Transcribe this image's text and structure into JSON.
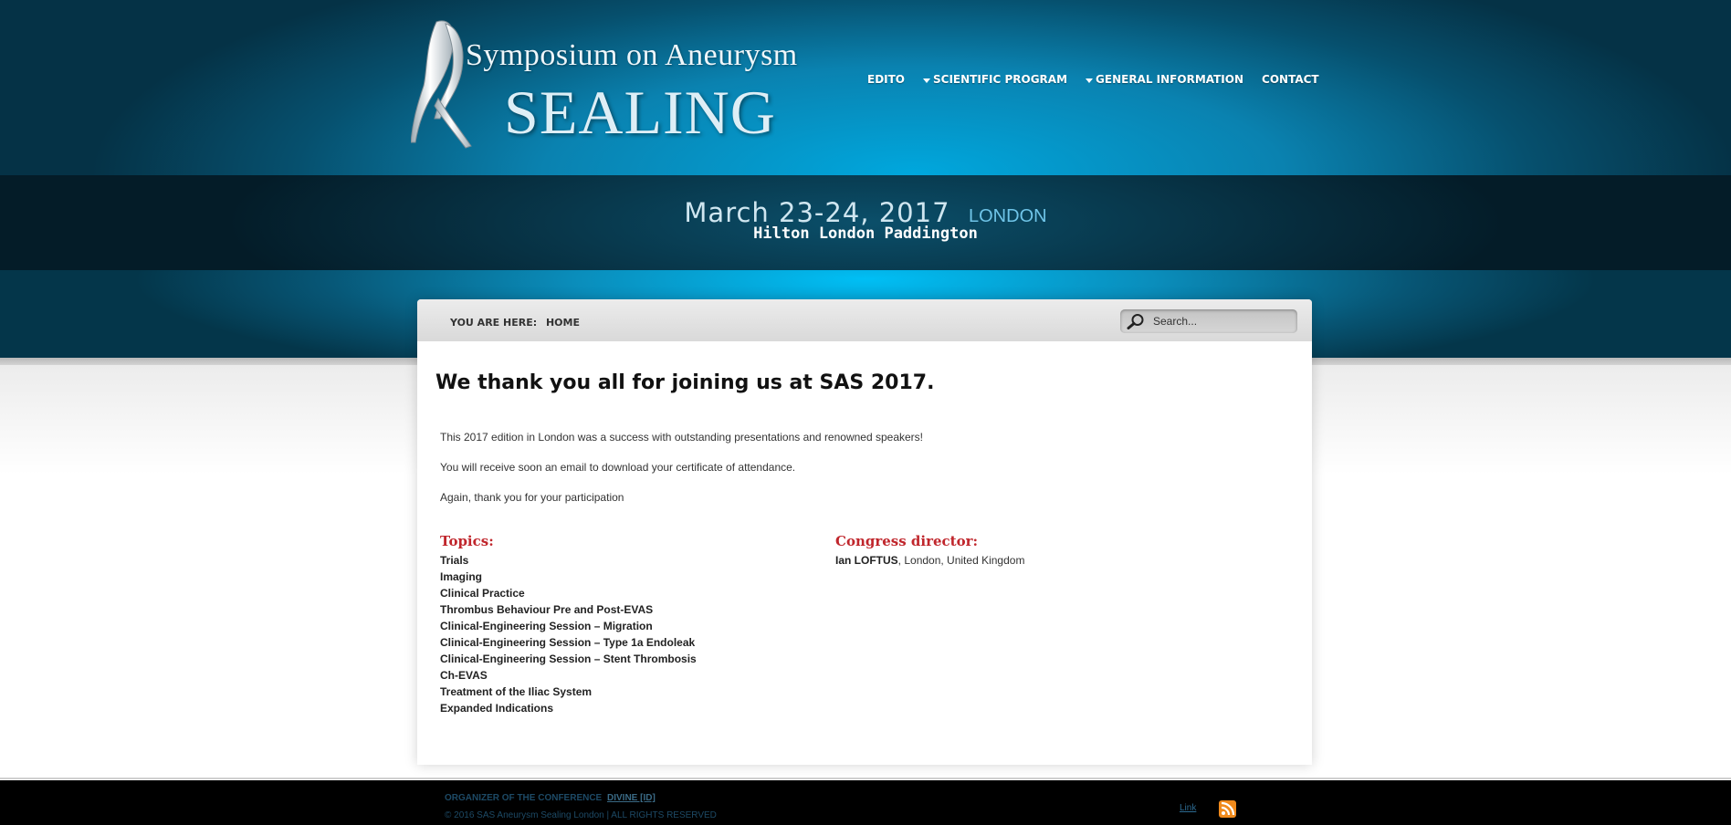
{
  "header": {
    "logo_line1": "Symposium on Aneurysm",
    "logo_line2": "SEALING",
    "nav": {
      "edito": "EDITO",
      "scientific_program": "SCIENTIFIC PROGRAM",
      "general_information": "GENERAL INFORMATION",
      "contact": "CONTACT"
    }
  },
  "event": {
    "date": "March 23-24, 2017",
    "city": "LONDON",
    "venue": "Hilton London Paddington"
  },
  "breadcrumb": {
    "prefix": "YOU ARE HERE:",
    "current": "HOME"
  },
  "search": {
    "placeholder": "Search..."
  },
  "content": {
    "headline": "We thank you all for joining us at SAS 2017.",
    "paragraphs": [
      "This 2017 edition in London was a success with outstanding presentations and renowned speakers!",
      "You will receive soon an email to download your certificate of attendance.",
      "Again, thank you for your participation"
    ],
    "topics_heading": "Topics:",
    "topics": [
      "Trials",
      "Imaging",
      "Clinical Practice",
      "Thrombus Behaviour Pre and Post-EVAS",
      "Clinical-Engineering Session – Migration",
      "Clinical-Engineering Session – Type 1a Endoleak",
      "Clinical-Engineering Session – Stent Thrombosis",
      "Ch-EVAS",
      "Treatment of the Iliac System",
      "Expanded Indications"
    ],
    "director_heading": "Congress director:",
    "director_name": "Ian LOFTUS",
    "director_location": ", London, United Kingdom"
  },
  "footer": {
    "organizer_label": "ORGANIZER OF THE CONFERENCE",
    "organizer_link": "DIVINE [ID]",
    "copyright": "© 2016 SAS Aneurysm Sealing London | ALL RIGHTS RESERVED",
    "link": "Link"
  },
  "colors": {
    "accent_red": "#c0262c",
    "header_blue": "#00a7dd",
    "rss_orange": "#f08a1c"
  },
  "icons": [
    "logo-vessel-icon",
    "chevron-down-icon",
    "search-icon",
    "rss-icon"
  ]
}
